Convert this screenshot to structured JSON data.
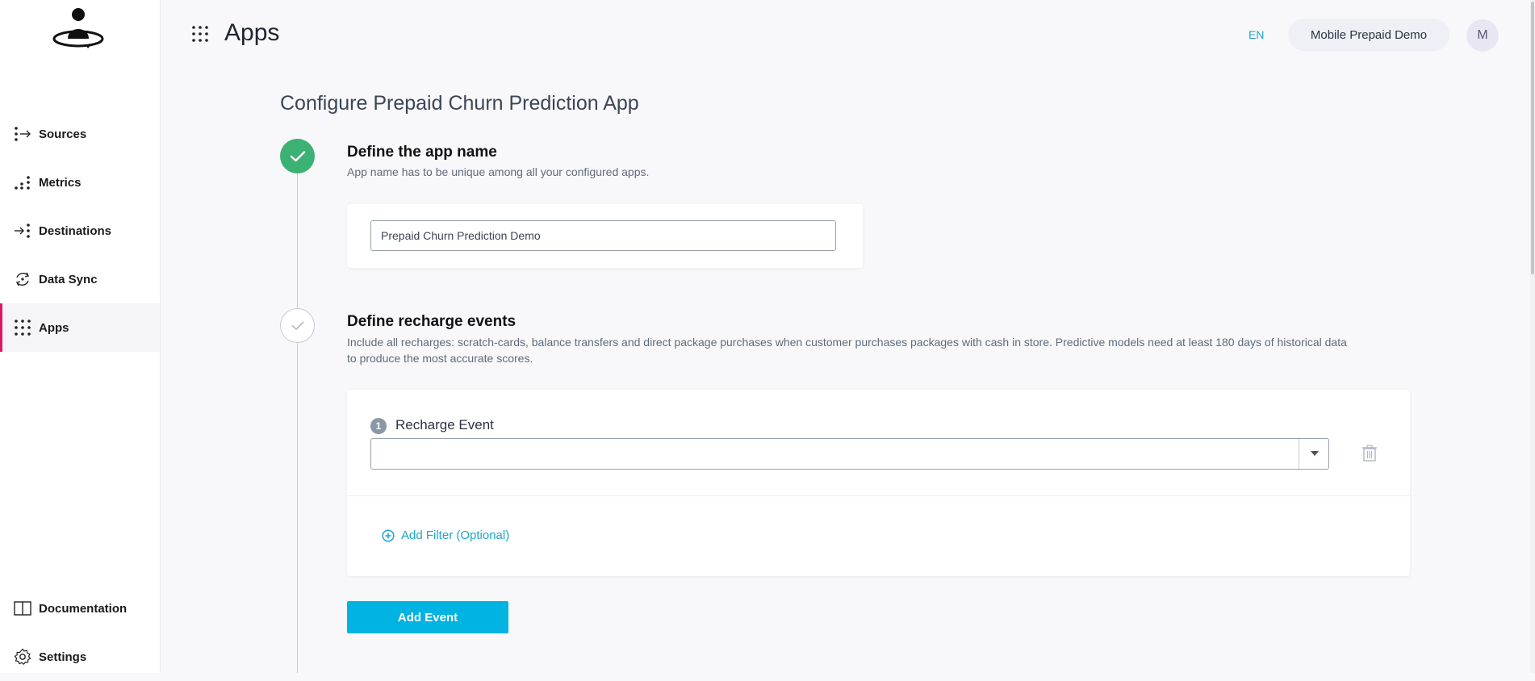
{
  "header": {
    "title": "Apps",
    "language": "EN",
    "workspace": "Mobile Prepaid Demo",
    "avatar_initial": "M"
  },
  "sidebar": {
    "items": [
      {
        "label": "Sources",
        "icon": "sources-icon"
      },
      {
        "label": "Metrics",
        "icon": "metrics-icon"
      },
      {
        "label": "Destinations",
        "icon": "destinations-icon"
      },
      {
        "label": "Data Sync",
        "icon": "data-sync-icon"
      },
      {
        "label": "Apps",
        "icon": "apps-grid-icon",
        "active": true
      }
    ],
    "bottom_items": [
      {
        "label": "Documentation",
        "icon": "book-icon"
      },
      {
        "label": "Settings",
        "icon": "gear-icon"
      }
    ]
  },
  "main": {
    "page_title": "Configure Prepaid Churn Prediction App",
    "steps": [
      {
        "title": "Define the app name",
        "description": "App name has to be unique among all your configured apps.",
        "status": "done",
        "input_value": "Prepaid Churn Prediction Demo"
      },
      {
        "title": "Define recharge events",
        "description_line1": "Include all recharges: scratch-cards, balance transfers and direct package purchases when customer purchases packages with cash in store. Predictive models need at least 180 days of historical data",
        "description_line2": "to produce the most accurate scores.",
        "status": "pending",
        "event": {
          "number": "1",
          "label": "Recharge Event",
          "selected_value": ""
        },
        "add_filter_label": "Add Filter (Optional)",
        "add_event_label": "Add Event"
      }
    ]
  },
  "colors": {
    "accent": "#00b3e0",
    "link": "#1fa5c7",
    "success": "#3bb273",
    "active_marker": "#d81b60"
  }
}
